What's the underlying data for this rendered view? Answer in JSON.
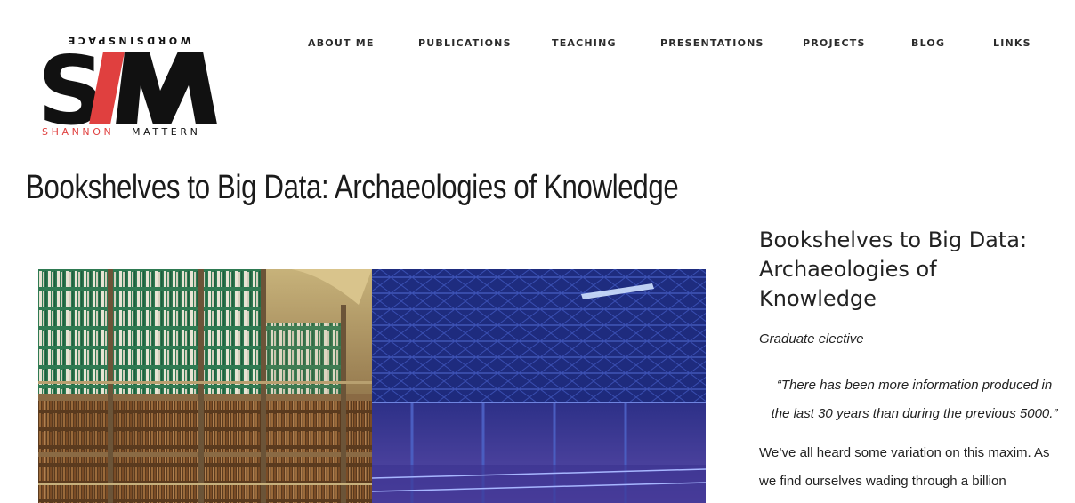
{
  "logo": {
    "top_text": "WORDSINSPACE",
    "main_letters": "SIM",
    "bottom_first": "SHANNON",
    "bottom_last": "MATTERN",
    "accent_color": "#e0403f",
    "ink_color": "#111111"
  },
  "nav": {
    "items": [
      {
        "label": "ABOUT ME"
      },
      {
        "label": "PUBLICATIONS"
      },
      {
        "label": "TEACHING"
      },
      {
        "label": "PRESENTATIONS"
      },
      {
        "label": "PROJECTS"
      },
      {
        "label": "BLOG"
      },
      {
        "label": "LINKS"
      }
    ]
  },
  "page": {
    "title": "Bookshelves to Big Data: Archaeologies of Knowledge"
  },
  "hero": {
    "left_scene": "library-bookshelves",
    "right_scene": "data-warehouse"
  },
  "sidebar": {
    "title": "Bookshelves to Big Data: Archaeologies of Knowledge",
    "subtitle": "Graduate elective",
    "quote": "“There has been more information produced in the last 30 years than during the previous 5000.”",
    "body": "We’ve all heard some variation on this maxim. As we find ourselves wading through a billion"
  }
}
